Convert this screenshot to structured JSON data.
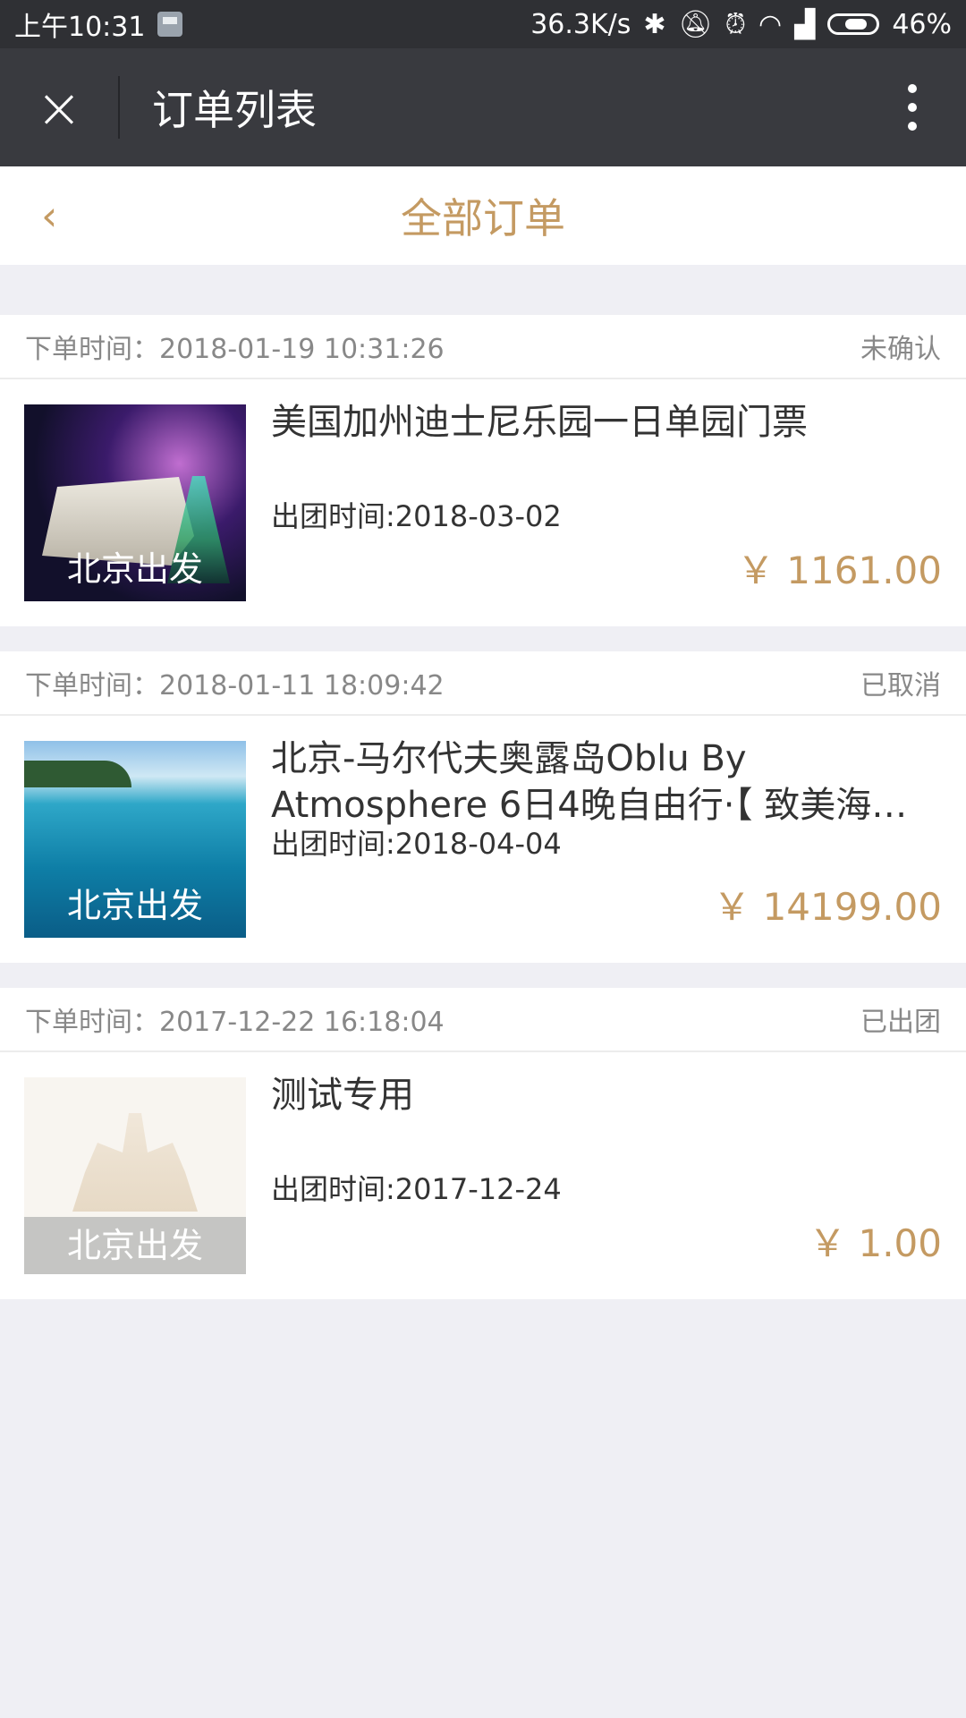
{
  "status_bar": {
    "time": "上午10:31",
    "net_speed": "36.3K/s",
    "battery_text": "46%",
    "battery_level": 0.46,
    "icons": [
      "sim-card-icon",
      "bluetooth-icon",
      "mute-icon",
      "alarm-icon",
      "wifi-icon",
      "signal-icon",
      "battery-icon"
    ]
  },
  "titlebar": {
    "title": "订单列表",
    "close_icon": "×"
  },
  "subheader": {
    "back_icon": "‹",
    "title": "全部订单"
  },
  "orders": [
    {
      "order_time": "下单时间：2018-01-19 10:31:26",
      "status": "未确认",
      "title": "美国加州迪士尼乐园一日单园门票",
      "departure": "出团时间:2018-03-02",
      "price": "￥ 1161.00",
      "origin": "北京出发"
    },
    {
      "order_time": "下单时间：2018-01-11 18:09:42",
      "status": "已取消",
      "title": "北京-马尔代夫奥露岛Oblu By Atmosphere 6日4晚自由行·【 致美海…",
      "departure": "出团时间:2018-04-04",
      "price": "￥ 14199.00",
      "origin": "北京出发"
    },
    {
      "order_time": "下单时间：2017-12-22 16:18:04",
      "status": "已出团",
      "title": "测试专用",
      "departure": "出团时间:2017-12-24",
      "price": "￥ 1.00",
      "origin": "北京出发"
    }
  ],
  "colors": {
    "accent": "#c49a62",
    "titlebar_bg": "#393a3f",
    "statusbar_bg": "#2f3034",
    "page_bg": "#efeff4"
  }
}
